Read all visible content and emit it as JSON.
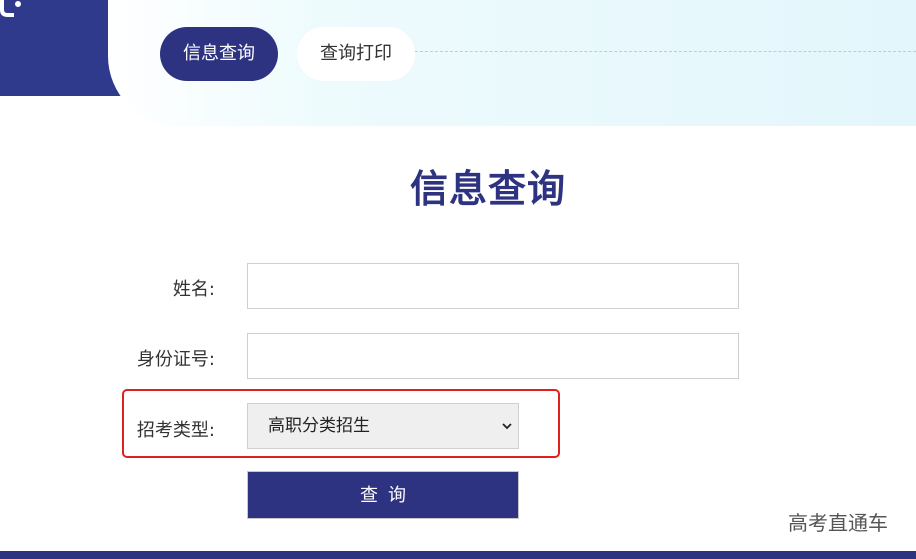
{
  "tabs": [
    {
      "label": "信息查询",
      "active": true
    },
    {
      "label": "查询打印",
      "active": false
    }
  ],
  "page": {
    "title": "信息查询"
  },
  "form": {
    "name_label": "姓名:",
    "name_value": "",
    "id_label": "身份证号:",
    "id_value": "",
    "type_label": "招考类型:",
    "type_selected": "高职分类招生",
    "submit_label": "查询"
  },
  "watermark": "高考直通车",
  "colors": {
    "primary": "#2d3380",
    "highlight": "#e02020",
    "panel_bg": "#e2f6fb"
  }
}
